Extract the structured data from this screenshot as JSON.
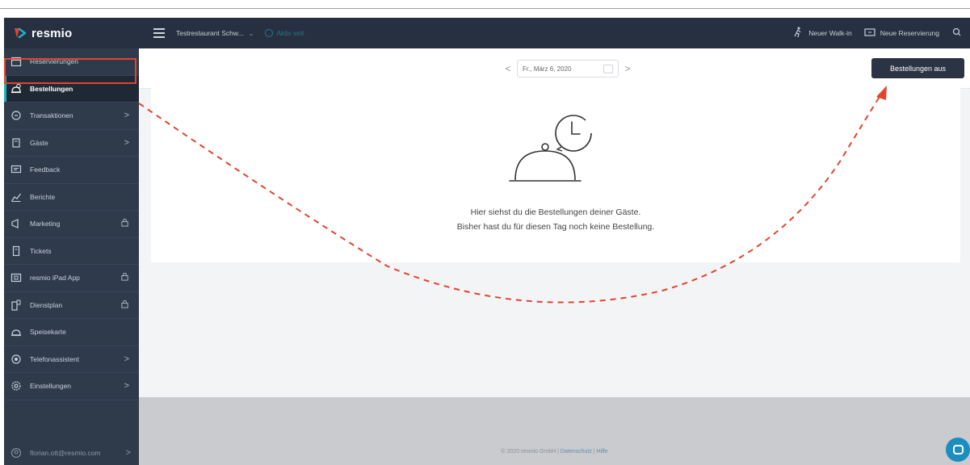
{
  "app": {
    "logo_text": "resmio"
  },
  "header": {
    "restaurant": "Testrestaurant Schw...",
    "status": "Aktiv seit",
    "walkin_label": "Neuer Walk-in",
    "reservation_label": "Neue Reservierung"
  },
  "sidebar": {
    "items": [
      {
        "label": "Reservierungen",
        "icon": "calendar-icon",
        "suffix": ""
      },
      {
        "label": "Bestellungen",
        "icon": "order-bell-icon",
        "suffix": ""
      },
      {
        "label": "Transaktionen",
        "icon": "transactions-icon",
        "suffix": ">"
      },
      {
        "label": "Gäste",
        "icon": "guests-icon",
        "suffix": ">"
      },
      {
        "label": "Feedback",
        "icon": "feedback-icon",
        "suffix": ""
      },
      {
        "label": "Berichte",
        "icon": "reports-icon",
        "suffix": ""
      },
      {
        "label": "Marketing",
        "icon": "marketing-icon",
        "suffix": "lock"
      },
      {
        "label": "Tickets",
        "icon": "tickets-icon",
        "suffix": ""
      },
      {
        "label": "resmio iPad App",
        "icon": "ipad-icon",
        "suffix": "lock"
      },
      {
        "label": "Dienstplan",
        "icon": "schedule-icon",
        "suffix": "lock"
      },
      {
        "label": "Speisekarte",
        "icon": "menu-card-icon",
        "suffix": ""
      },
      {
        "label": "Telefonassistent",
        "icon": "phone-assistant-icon",
        "suffix": ">"
      },
      {
        "label": "Einstellungen",
        "icon": "settings-icon",
        "suffix": ">"
      }
    ],
    "user": "florian.ott@resmio.com"
  },
  "toolbar": {
    "prev": "<",
    "next": ">",
    "date": "Fr., März 6, 2020",
    "toggle_orders_label": "Bestellungen aus"
  },
  "empty_state": {
    "line1": "Hier siehst du die Bestellungen deiner Gäste.",
    "line2": "Bisher hast du für diesen Tag noch keine Bestellung."
  },
  "footer": {
    "copyright": "© 2020 resmio GmbH",
    "privacy": "Datenschutz",
    "help": "Hilfe",
    "separator": "|"
  },
  "colors": {
    "sidebar_bg": "#2f3a4b",
    "header_bg": "#263040",
    "accent": "#1eb3c4",
    "annotation": "#e2442f",
    "primary_button": "#2b3444"
  }
}
